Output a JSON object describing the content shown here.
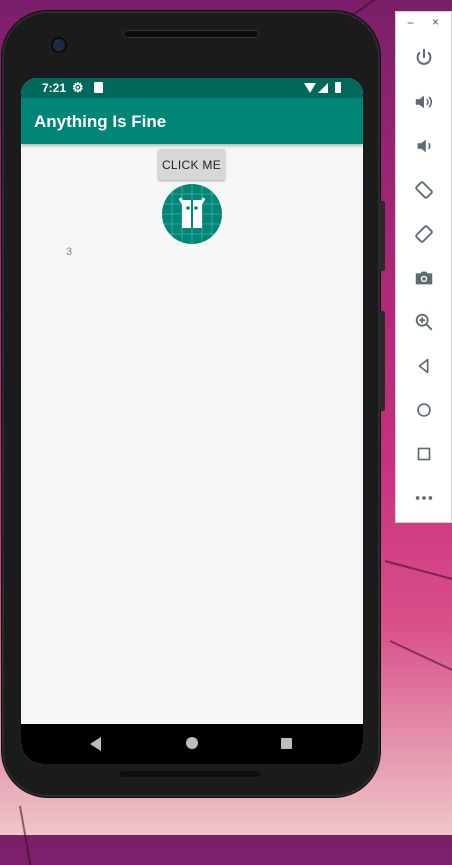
{
  "status_bar": {
    "time": "7:21"
  },
  "app": {
    "title": "Anything Is Fine"
  },
  "main": {
    "button_label": "CLICK ME",
    "count": "3"
  },
  "emulator_panel": {
    "buttons": [
      "power-icon",
      "volume-up-icon",
      "volume-down-icon",
      "rotate-left-icon",
      "rotate-right-icon",
      "camera-icon",
      "zoom-icon",
      "back-icon",
      "home-icon",
      "overview-icon",
      "more-icon"
    ],
    "minimize": "−",
    "close": "×"
  },
  "colors": {
    "status_bar": "#00695c",
    "app_bar": "#008577",
    "panel_icon": "#5f6b73"
  }
}
